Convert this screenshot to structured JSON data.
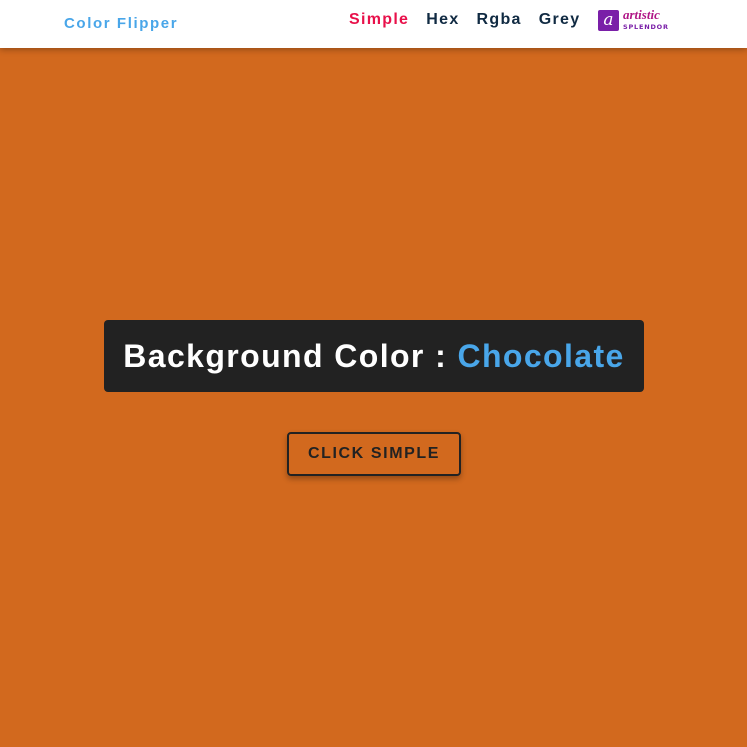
{
  "nav": {
    "brand": "Color Flipper",
    "links": [
      {
        "label": "Simple",
        "active": true
      },
      {
        "label": "Hex",
        "active": false
      },
      {
        "label": "Rgba",
        "active": false
      },
      {
        "label": "Grey",
        "active": false
      }
    ],
    "logo": {
      "mark": "a",
      "line1": "artistic",
      "line2": "SPLENDOR"
    }
  },
  "main": {
    "label": "Background Color :",
    "color_name": "Chocolate",
    "button_label": "CLICK SIMPLE"
  },
  "colors": {
    "background": "#d2691e",
    "brand": "#49a6e9",
    "active_link": "#e8104a",
    "link": "#102a42",
    "box": "#222222"
  }
}
